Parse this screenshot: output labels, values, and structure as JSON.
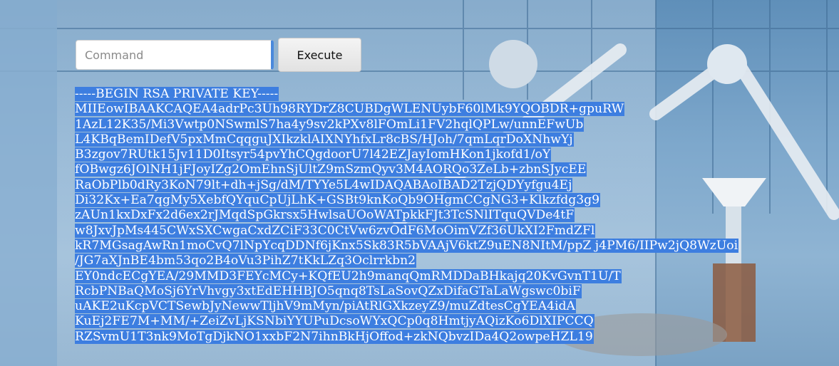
{
  "command_bar": {
    "input_placeholder": "Command",
    "input_value": "",
    "execute_label": "Execute"
  },
  "output": {
    "lines": [
      "-----BEGIN RSA PRIVATE KEY-----",
      "MIIEowIBAAKCAQEA4adrPc3Uh98RYDrZ8CUBDgWLENUybF60lMk9YQOBDR+gpuRW",
      "1AzL12K35/Mi3Vwtp0NSwmlS7ha4y9sv2kPXv8lFOmLi1FV2hqlQPLw/unnEFwUb",
      "L4KBqBemIDefV5pxMmCqqguJXIkzklAIXNYhfxLr8cBS/HJoh/7qmLqrDoXNhwYj",
      "B3zgov7RUtk15Jv11D0Itsyr54pvYhCQgdoorU7l42EZJayIomHKon1jkofd1/oY",
      "fOBwgz6JOlNH1jFJoyIZg2OmEhnSjUltZ9mSzmQyv3M4AORQo3ZeLb+zbnSJycEE",
      "RaObPlb0dRy3KoN79lt+dh+jSg/dM/TYYe5L4wIDAQABAoIBAD2TzjQDYyfgu4Ej",
      "Di32Kx+Ea7qgMy5XebfQYquCpUjLhK+GSBt9knKoQb9OHgmCCgNG3+Klkzfdg3g9",
      "zAUn1kxDxFx2d6ex2rJMqdSpGkrsx5HwlsaUOoWATpkkFJt3TcSNlITquQVDe4tF",
      "w8JxvJpMs445CWxSXCwgaCxdZCiF33C0CtVw6zvOdF6MoOimVZf36UkXI2FmdZFl",
      "kR7MGsagAwRn1moCvQ7lNpYcqDDNf6jKnx5Sk83R5bVAAjV6ktZ9uEN8NItM/ppZ j4PM6/IIPw2jQ8WzUoi",
      "/JG7aXJnBE4bm53qo2B4oVu3PihZ7tKkLZq3Oclrrkbn2",
      "EY0ndcECgYEA/29MMD3FEYcMCy+KQfEU2h9manqQmRMDDaBHkajq20KvGvnT1U/T",
      "RcbPNBaQMoSj6YrVhvgy3xtEdEHHBJO5qnq8TsLaSovQZxDifaGTaLaWgswc0biF",
      "uAKE2uKcpVCTSewbJyNewwTljhV9mMyn/piAtRlGXkzeyZ9/muZdtesCgYEA4idA",
      "KuEj2FE7M+MM/+ZeiZvLjKSNbiYYUPuDcsoWYxQCp0q8HmtjyAQizKo6DlXIPCCQ",
      "RZSvmU1T3nk9MoTgDjkNO1xxbF2N7ihnBkHjOffod+zkNQbvzIDa4Q2owpeHZL19"
    ]
  }
}
